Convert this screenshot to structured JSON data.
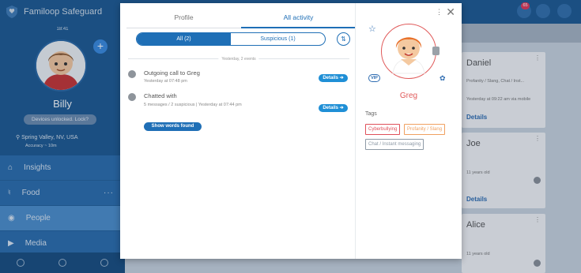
{
  "app": {
    "brand": "Familoop Safeguard",
    "time": "18:41",
    "child_name": "Billy",
    "device_status": "Devices unlocked. Lock?",
    "location": "Spring Valley, NV, USA",
    "accuracy": "Accuracy ~ 10m",
    "notification_count": "65",
    "nav": [
      {
        "label": "Insights",
        "icon": "insights-icon"
      },
      {
        "label": "Food",
        "icon": "food-icon"
      },
      {
        "label": "People",
        "icon": "people-icon"
      },
      {
        "label": "Media",
        "icon": "media-icon"
      }
    ],
    "cards": [
      {
        "name": "Daniel",
        "sub": "Profanity / Slang, Chat / Inst...",
        "meta": "Yesterday at 09:22 am via mobile",
        "link": "Details"
      },
      {
        "name": "Joe",
        "sub": "11 years old",
        "link": "Details"
      },
      {
        "name": "Alice",
        "sub": "11 years old"
      }
    ]
  },
  "modal": {
    "tabs": [
      "Profile",
      "All activity"
    ],
    "filters": [
      "All (2)",
      "Suspicious (1)"
    ],
    "day_divider": "Yesterday, 2 events",
    "activities": [
      {
        "title": "Outgoing call to Greg",
        "meta": "Yesterday at 07:48 pm",
        "details": "Details ➔"
      },
      {
        "title": "Chatted with",
        "meta": "5 messages / 2 suspicious | Yesterday at 07:44 pm",
        "details": "Details ➔",
        "words_button": "Show words found"
      }
    ],
    "contact": {
      "name": "Greg",
      "vip": "VIP",
      "tags_label": "Tags",
      "tags": [
        {
          "label": "Cyberbullying",
          "color": "#e0505a"
        },
        {
          "label": "Profanity / Slang",
          "color": "#f0a060"
        },
        {
          "label": "Chat / Instant messaging",
          "color": "#8e9aa6"
        }
      ]
    }
  }
}
